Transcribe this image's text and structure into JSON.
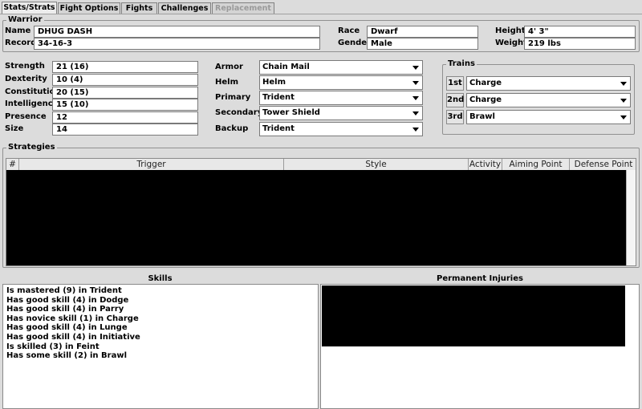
{
  "tabs": [
    {
      "label": "Stats/Strats",
      "active": true
    },
    {
      "label": "Fight Options",
      "active": false
    },
    {
      "label": "Fights",
      "active": false
    },
    {
      "label": "Challenges",
      "active": false
    },
    {
      "label": "Replacement",
      "disabled": true
    }
  ],
  "warrior": {
    "title": "Warrior",
    "name_label": "Name",
    "name": "DHUG DASH",
    "record_label": "Record",
    "record": "34-16-3",
    "race_label": "Race",
    "race": "Dwarf",
    "gender_label": "Gender",
    "gender": "Male",
    "height_label": "Height",
    "height": "4' 3\"",
    "weight_label": "Weight",
    "weight": "219 lbs"
  },
  "stats": {
    "strength_label": "Strength",
    "strength": "21 (16)",
    "dexterity_label": "Dexterity",
    "dexterity": "10 (4)",
    "constitution_label": "Constitution",
    "constitution": "20 (15)",
    "intelligence_label": "Intelligence",
    "intelligence": "15 (10)",
    "presence_label": "Presence",
    "presence": "12",
    "size_label": "Size",
    "size": "14"
  },
  "equipment": {
    "armor_label": "Armor",
    "armor": "Chain Mail",
    "helm_label": "Helm",
    "helm": "Helm",
    "primary_label": "Primary",
    "primary": "Trident",
    "secondary_label": "Secondary",
    "secondary": "Tower Shield",
    "backup_label": "Backup",
    "backup": "Trident"
  },
  "trains": {
    "title": "Trains",
    "first_label": "1st",
    "first": "Charge",
    "second_label": "2nd",
    "second": "Charge",
    "third_label": "3rd",
    "third": "Brawl"
  },
  "strategies": {
    "title": "Strategies",
    "columns": [
      "#",
      "Trigger",
      "Style",
      "Activity",
      "Aiming Point",
      "Defense Point"
    ]
  },
  "skills": {
    "title": "Skills",
    "items": [
      "Is mastered (9) in Trident",
      "Has good skill (4) in Dodge",
      "Has good skill (4) in Parry",
      "Has novice skill (1) in Charge",
      "Has good skill (4) in Lunge",
      "Has good skill (4) in Initiative",
      "Is skilled (3) in Feint",
      "Has some skill (2) in Brawl"
    ]
  },
  "injuries": {
    "title": "Permanent Injuries"
  }
}
